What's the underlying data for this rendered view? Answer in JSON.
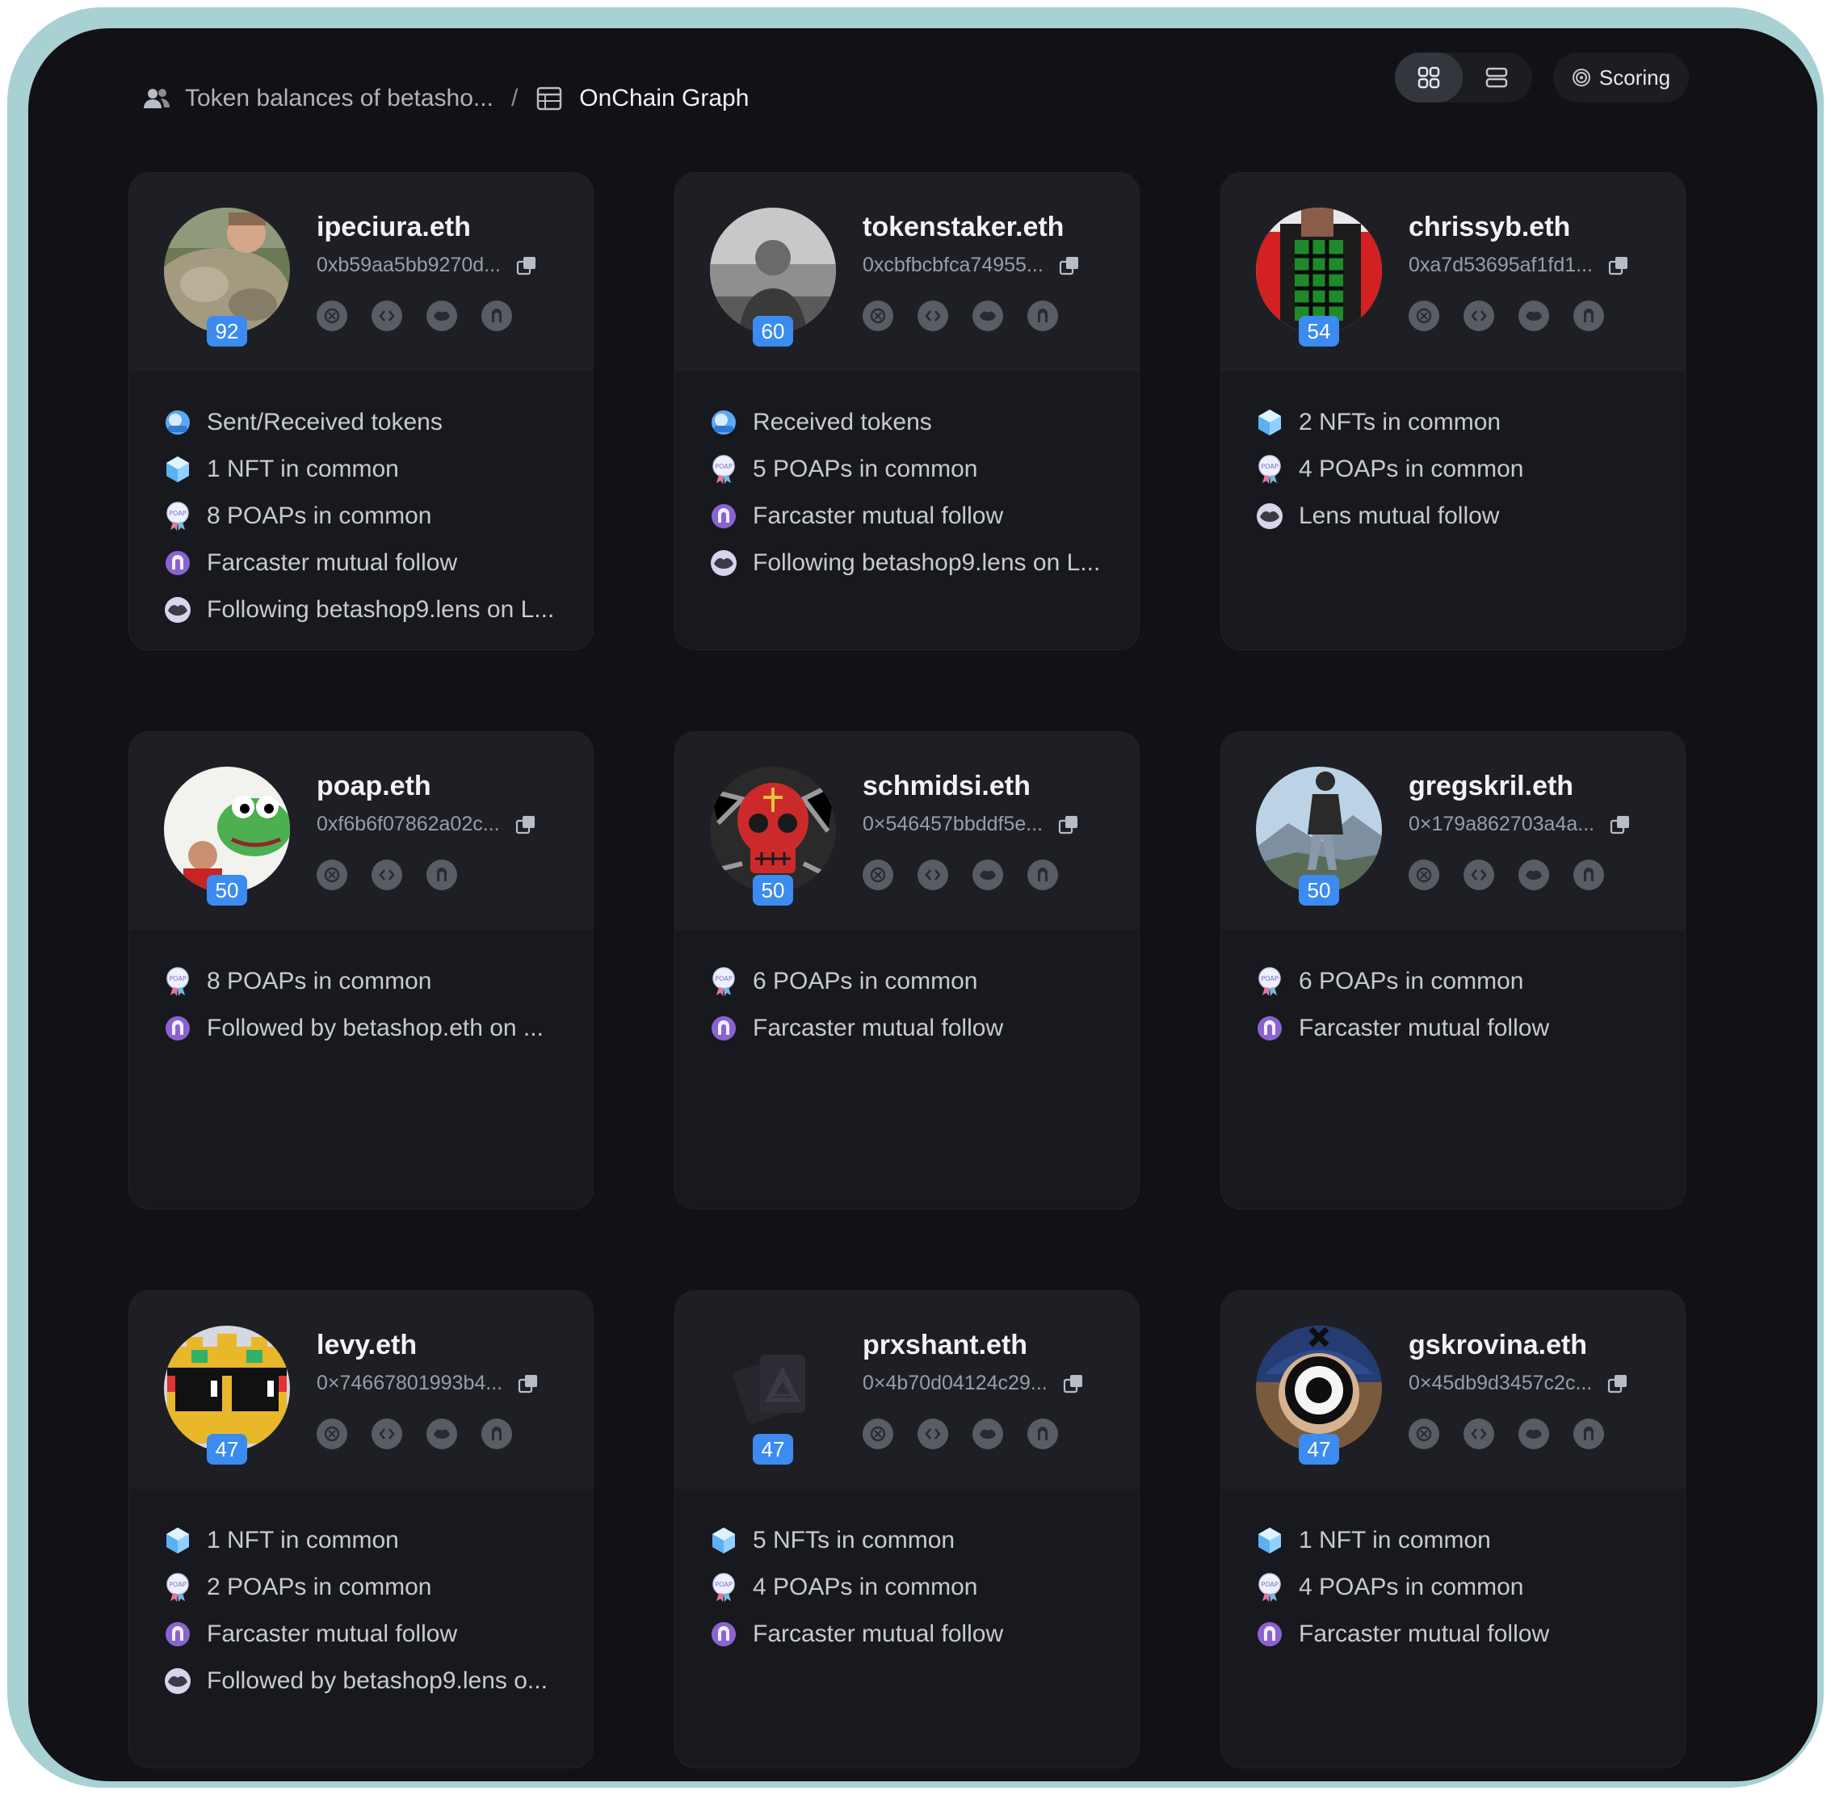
{
  "breadcrumb": {
    "parent": "Token balances of betasho...",
    "separator": "/",
    "current": "OnChain Graph"
  },
  "toolbar": {
    "grid_view": "grid-view-icon",
    "list_view": "list-view-icon",
    "scoring_label": "Scoring"
  },
  "colors": {
    "accent": "#3c8bf0",
    "farcaster": "#8a63d2",
    "background": "#111116"
  },
  "cards": [
    {
      "name": "ipeciura.eth",
      "address": "0xb59aa5bb9270d...",
      "score": "92",
      "socials": [
        "ens-icon",
        "code-icon",
        "lens-icon",
        "farcaster-icon"
      ],
      "avatar": "avatar-rock",
      "reasons": [
        {
          "icon": "token-icon",
          "text": "Sent/Received tokens"
        },
        {
          "icon": "nft-icon",
          "text": "1 NFT in common"
        },
        {
          "icon": "poap-icon",
          "text": "8 POAPs in common"
        },
        {
          "icon": "farcaster-icon",
          "text": "Farcaster mutual follow"
        },
        {
          "icon": "lens-icon",
          "text": "Following betashop9.lens on L..."
        }
      ]
    },
    {
      "name": "tokenstaker.eth",
      "address": "0xcbfbcbfca74955...",
      "score": "60",
      "socials": [
        "ens-icon",
        "code-icon",
        "lens-icon",
        "farcaster-icon"
      ],
      "avatar": "avatar-photo",
      "reasons": [
        {
          "icon": "token-icon",
          "text": "Received tokens"
        },
        {
          "icon": "poap-icon",
          "text": "5 POAPs in common"
        },
        {
          "icon": "farcaster-icon",
          "text": "Farcaster mutual follow"
        },
        {
          "icon": "lens-icon",
          "text": "Following betashop9.lens on L..."
        }
      ]
    },
    {
      "name": "chrissyb.eth",
      "address": "0xa7d53695af1fd1...",
      "score": "54",
      "socials": [
        "ens-icon",
        "code-icon",
        "lens-icon",
        "farcaster-icon"
      ],
      "avatar": "avatar-pixel",
      "reasons": [
        {
          "icon": "nft-icon",
          "text": "2 NFTs in common"
        },
        {
          "icon": "poap-icon",
          "text": "4 POAPs in common"
        },
        {
          "icon": "lens-icon",
          "text": "Lens mutual follow"
        }
      ]
    },
    {
      "name": "poap.eth",
      "address": "0xf6b6f07862a02c...",
      "score": "50",
      "socials": [
        "ens-icon",
        "code-icon",
        "farcaster-icon"
      ],
      "avatar": "avatar-frog",
      "reasons": [
        {
          "icon": "poap-icon",
          "text": "8 POAPs in common"
        },
        {
          "icon": "farcaster-icon",
          "text": "Followed by betashop.eth on ..."
        }
      ]
    },
    {
      "name": "schmidsi.eth",
      "address": "0×546457bbddf5e...",
      "score": "50",
      "socials": [
        "ens-icon",
        "code-icon",
        "lens-icon",
        "farcaster-icon"
      ],
      "avatar": "avatar-skull",
      "reasons": [
        {
          "icon": "poap-icon",
          "text": "6 POAPs in common"
        },
        {
          "icon": "farcaster-icon",
          "text": "Farcaster mutual follow"
        }
      ]
    },
    {
      "name": "gregskril.eth",
      "address": "0×179a862703a4a...",
      "score": "50",
      "socials": [
        "ens-icon",
        "code-icon",
        "lens-icon",
        "farcaster-icon"
      ],
      "avatar": "avatar-mountain",
      "reasons": [
        {
          "icon": "poap-icon",
          "text": "6 POAPs in common"
        },
        {
          "icon": "farcaster-icon",
          "text": "Farcaster mutual follow"
        }
      ]
    },
    {
      "name": "levy.eth",
      "address": "0×74667801993b4...",
      "score": "47",
      "socials": [
        "ens-icon",
        "code-icon",
        "lens-icon",
        "farcaster-icon"
      ],
      "avatar": "avatar-noun",
      "reasons": [
        {
          "icon": "nft-icon",
          "text": "1 NFT in common"
        },
        {
          "icon": "poap-icon",
          "text": "2 POAPs in common"
        },
        {
          "icon": "farcaster-icon",
          "text": "Farcaster mutual follow"
        },
        {
          "icon": "lens-icon",
          "text": "Followed by betashop9.lens o..."
        }
      ]
    },
    {
      "name": "prxshant.eth",
      "address": "0×4b70d04124c29...",
      "score": "47",
      "socials": [
        "ens-icon",
        "code-icon",
        "lens-icon",
        "farcaster-icon"
      ],
      "avatar": "avatar-placeholder",
      "reasons": [
        {
          "icon": "nft-icon",
          "text": "5 NFTs in common"
        },
        {
          "icon": "poap-icon",
          "text": "4 POAPs in common"
        },
        {
          "icon": "farcaster-icon",
          "text": "Farcaster mutual follow"
        }
      ]
    },
    {
      "name": "gskrovina.eth",
      "address": "0×45db9d3457c2c...",
      "score": "47",
      "socials": [
        "ens-icon",
        "code-icon",
        "lens-icon",
        "farcaster-icon"
      ],
      "avatar": "avatar-eye",
      "reasons": [
        {
          "icon": "nft-icon",
          "text": "1 NFT in common"
        },
        {
          "icon": "poap-icon",
          "text": "4 POAPs in common"
        },
        {
          "icon": "farcaster-icon",
          "text": "Farcaster mutual follow"
        }
      ]
    }
  ]
}
